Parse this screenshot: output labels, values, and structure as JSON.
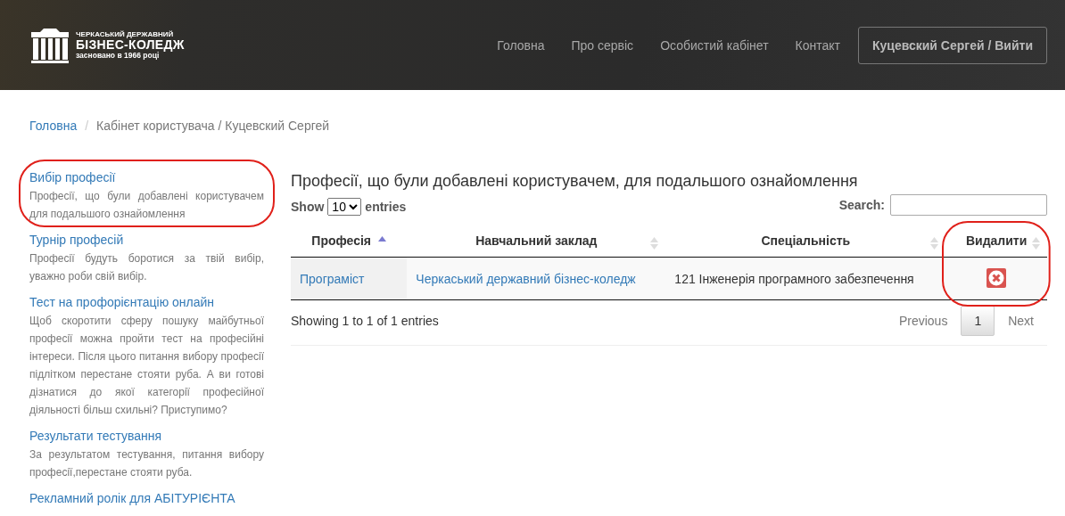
{
  "header": {
    "logo": {
      "line_1": "ЧЕРКАСЬКИЙ ДЕРЖАВНИЙ",
      "line_2": "БІЗНЕС-КОЛЕДЖ",
      "line_3": "засновано в 1966 році"
    },
    "nav": [
      "Головна",
      "Про сервіс",
      "Особистий кабінет",
      "Контакт"
    ],
    "account_button": "Куцевский Сергей / Вийти"
  },
  "breadcrumb": {
    "home": "Головна",
    "separator": "/",
    "current": "Кабінет користувача / Куцевский Сергей"
  },
  "sidebar": {
    "items": [
      {
        "title": "Вибір професії",
        "description": "Професії, що були добавлені користувачем для подальшого ознайомлення",
        "circled": true
      },
      {
        "title": "Турнір професій",
        "description": "Професії будуть боротися за твій вибір, уважно роби свій вибір.",
        "circled": false
      },
      {
        "title": "Тест на профорієнтацію онлайн",
        "description": "Щоб скоротити сферу пошуку майбутньої професії можна пройти тест на професійні інтереси. Після цього питання вибору професії підлітком перестане стояти руба. А ви готові дізнатися до якої категорії професійної діяльності більш схильні? Приступимо?",
        "circled": false
      },
      {
        "title": "Результати тестування",
        "description": "За результатом тестування, питання вибору професії,перестане стояти руба.",
        "circled": false
      },
      {
        "title": "Рекламний ролік для АБІТУРІЄНТА",
        "circled": false
      }
    ]
  },
  "main": {
    "title": "Професії, що були добавлені користувачем, для подальшого ознайомлення",
    "length": {
      "show": "Show",
      "value": "10",
      "entries": "entries"
    },
    "search": {
      "label": "Search:"
    },
    "table": {
      "columns": [
        {
          "label": "Професія",
          "sorted": true,
          "circled": false
        },
        {
          "label": "Навчальний заклад",
          "sorted": false,
          "circled": false
        },
        {
          "label": "Спеціальність",
          "sorted": false,
          "circled": false
        },
        {
          "label": "Видалити",
          "sorted": false,
          "circled": true
        }
      ],
      "rows": [
        {
          "profession": "Програміст",
          "institution": "Черкаський державний бізнес-коледж",
          "specialty": "121 Інженерія програмного забезпечення"
        }
      ]
    },
    "info": "Showing 1 to 1 of 1 entries",
    "pagination": [
      {
        "label": "Previous",
        "selected": false
      },
      {
        "label": "1",
        "selected": true
      },
      {
        "label": "Next",
        "selected": false
      }
    ]
  }
}
